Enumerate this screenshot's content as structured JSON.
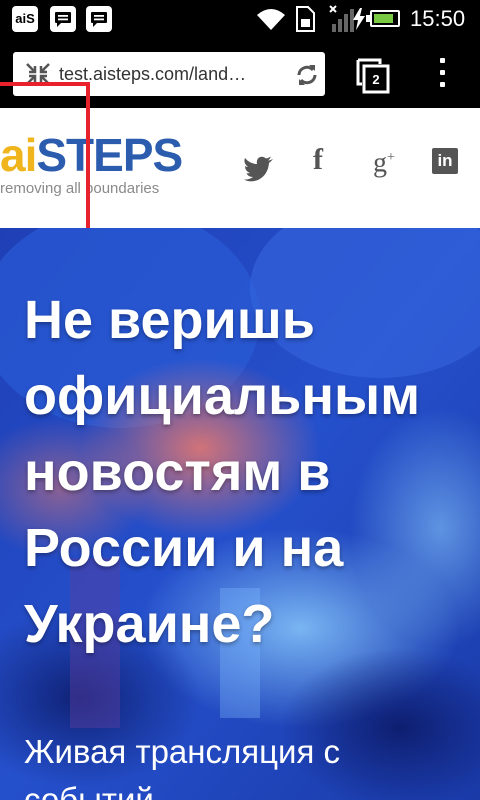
{
  "status_bar": {
    "notifications": [
      {
        "icon": "app-ais-icon",
        "label": "aiS"
      },
      {
        "icon": "chat-message-icon"
      },
      {
        "icon": "chat-message-icon"
      }
    ],
    "time": "15:50",
    "battery_level": 0.85,
    "battery_color": "#7ac943"
  },
  "browser": {
    "url": "test.aisteps.com/land…",
    "tab_count": "2"
  },
  "site": {
    "logo_ai": "ai",
    "logo_steps": "STEPS",
    "tagline": "removing all boundaries",
    "social": {
      "twitter_icon": "twitter-icon",
      "facebook": "f",
      "google": "g",
      "google_sup": "+",
      "linkedin": "in"
    },
    "colors": {
      "logo_ai": "#f0b41c",
      "logo_steps": "#2b5cae",
      "highlight": "#e8212b"
    }
  },
  "hero": {
    "title": "Не веришь\nофициальным\nновостям в\nРоссии и на\nУкраине?",
    "subtitle": "Живая трансляция с\nсобытий"
  }
}
